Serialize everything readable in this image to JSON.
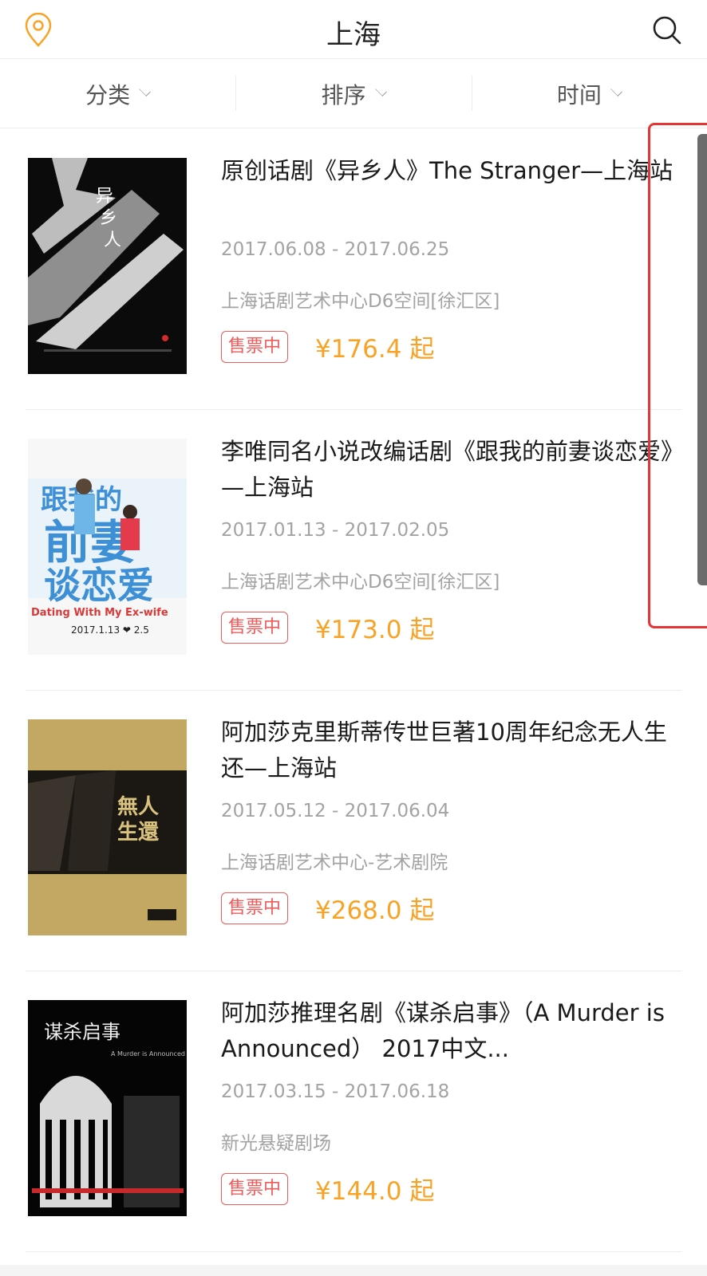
{
  "header": {
    "city": "上海"
  },
  "filters": [
    {
      "label": "分类"
    },
    {
      "label": "排序"
    },
    {
      "label": "时间"
    }
  ],
  "events": [
    {
      "title": "原创话剧《异乡人》The Stranger—上海站",
      "dates": "2017.06.08 - 2017.06.25",
      "venue": "上海话剧艺术中心D6空间[徐汇区]",
      "status": "售票中",
      "price": "¥176.4 起",
      "poster_text": [
        "异",
        "乡",
        "人"
      ]
    },
    {
      "title": "李唯同名小说改编话剧《跟我的前妻谈恋爱》—上海站",
      "dates": "2017.01.13 - 2017.02.05",
      "venue": "上海话剧艺术中心D6空间[徐汇区]",
      "status": "售票中",
      "price": "¥173.0 起",
      "poster_text": [
        "跟我的",
        "前妻",
        "谈恋爱",
        "Dating With My Ex-wife",
        "2017.1.13 ❤ 2.5"
      ]
    },
    {
      "title": "阿加莎克里斯蒂传世巨著10周年纪念无人生还—上海站",
      "dates": "2017.05.12 - 2017.06.04",
      "venue": "上海话剧艺术中心-艺术剧院",
      "status": "售票中",
      "price": "¥268.0 起",
      "poster_text": [
        "無人",
        "生還"
      ]
    },
    {
      "title": "阿加莎推理名剧《谋杀启事》（A Murder is Announced） 2017中文...",
      "dates": "2017.03.15 - 2017.06.18",
      "venue": "新光悬疑剧场",
      "status": "售票中",
      "price": "¥144.0 起",
      "poster_text": [
        "谋杀启事",
        "A Murder is Announced"
      ]
    }
  ],
  "colors": {
    "accent_orange": "#f8a325",
    "status_red": "#ef5a5a",
    "highlight_red": "#e53535"
  },
  "icons": {
    "location": "location-pin-icon",
    "search": "search-icon"
  }
}
